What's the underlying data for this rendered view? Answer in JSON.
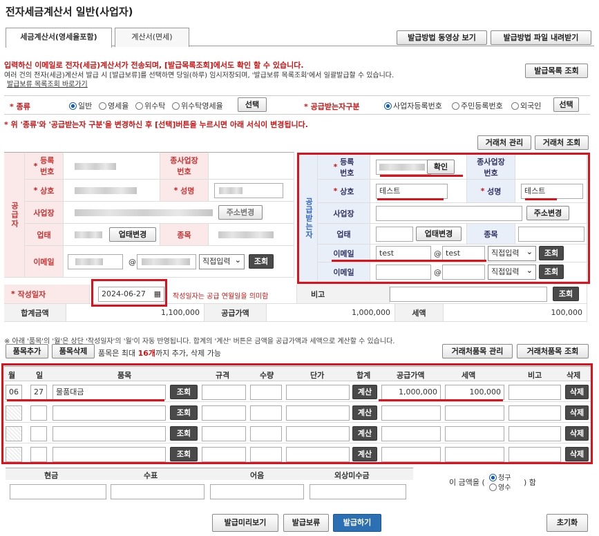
{
  "page_title": "전자세금계산서 일반(사업자)",
  "tabs": [
    "세금계산서(영세율포함)",
    "계산서(면세)"
  ],
  "top_buttons": {
    "video": "발급방법 동영상 보기",
    "download": "발급방법 파일 내려받기",
    "list": "발급목록 조회"
  },
  "notice": {
    "line1": "입력하신 이메일로 전자(세금)계산서가 전송되며, [발급목록조회]에서도 확인 할 수 있습니다.",
    "line2": "여러 건의 전자(세금)계산서 발급 시 [발급보류]를 선택하면 당일(하루) 임시저장되며, '발급보류 목록조회'에서 일괄발급할 수 있습니다.",
    "link": "발급보류 목록조회 바로가기"
  },
  "type_row": {
    "label": "종류",
    "options": [
      "일반",
      "영세율",
      "위수탁",
      "위수탁영세율"
    ],
    "select_btn": "선택",
    "recipient_label": "공급받는자구분",
    "recipient_options": [
      "사업자등록번호",
      "주민등록번호",
      "외국인"
    ],
    "recipient_btn": "선택"
  },
  "warning": "* 위 '종류'와 '공급받는자 구분'을 변경하신 후 [선택]버튼을 누르시면 아래 서식이 변경됩니다.",
  "partner_buttons": {
    "manage": "거래처 관리",
    "search": "거래처 조회"
  },
  "supplier": {
    "side_label": "공급자",
    "reg_no_label": "등록\n번호",
    "branch_label": "종사업장\n번호",
    "name_label": "상호",
    "ceo_label": "성명",
    "address_label": "사업장",
    "address_btn": "주소변경",
    "business_label": "업태",
    "business_btn": "업태변경",
    "item_label": "종목",
    "email_label": "이메일",
    "email_select": "직접입력",
    "email_btn": "조회"
  },
  "recipient": {
    "side_label": "공급받는자",
    "reg_no_label": "등록\n번호",
    "confirm_btn": "확인",
    "branch_label": "종사업장\n번호",
    "name_label": "상호",
    "name_value": "테스트",
    "ceo_label": "성명",
    "ceo_value": "테스트",
    "address_label": "사업장",
    "address_btn": "주소변경",
    "business_label": "업태",
    "business_btn": "업태변경",
    "item_label": "종목",
    "email_label": "이메일",
    "email_id": "test",
    "email_domain": "test",
    "email_select": "직접입력",
    "email_btn": "조회",
    "email2_label": "이메일",
    "email2_select": "직접입력",
    "email2_btn": "조회"
  },
  "date_row": {
    "label": "작성일자",
    "value": "2024-06-27",
    "hint": "작성일자는 공급 연월일을 의미함",
    "note_label": "비고",
    "note_btn": "조회"
  },
  "totals": {
    "total_label": "합계금액",
    "total": "1,100,000",
    "supply_label": "공급가액",
    "supply": "1,000,000",
    "tax_label": "세액",
    "tax": "100,000"
  },
  "items_notice": "※ 아래 '품목'의 '월'은 상단 '작성일자'의 '월'이 자동 반영됩니다. 합계의 '계산' 버튼은 금액을 공급가액과 세액으로 계산할 수 있습니다.",
  "items_toolbar": {
    "add": "품목추가",
    "delete": "품목삭제",
    "limit_pre": "품목은 최대 ",
    "limit_num": "16개",
    "limit_post": "까지 추가, 삭제 가능",
    "manage": "거래처품목 관리",
    "search": "거래처품목 조회"
  },
  "items_headers": [
    "월",
    "일",
    "품목",
    "규격",
    "수량",
    "단가",
    "합계",
    "공급가액",
    "세액",
    "비고",
    "삭제"
  ],
  "item_buttons": {
    "search": "조회",
    "calc": "계산",
    "delete": "삭제"
  },
  "items": [
    {
      "month": "06",
      "day": "27",
      "name": "물품대금",
      "supply": "1,000,000",
      "tax": "100,000"
    },
    {
      "month": "",
      "day": "",
      "name": "",
      "supply": "",
      "tax": ""
    },
    {
      "month": "",
      "day": "",
      "name": "",
      "supply": "",
      "tax": ""
    },
    {
      "month": "",
      "day": "",
      "name": "",
      "supply": "",
      "tax": ""
    }
  ],
  "payment": {
    "headers": [
      "현금",
      "수표",
      "어음",
      "외상미수금"
    ],
    "amount_pre": "이 금액을 (",
    "claim": "청구",
    "receipt": "영수",
    "amount_post": ") 함"
  },
  "bottom_buttons": {
    "preview": "발급미리보기",
    "hold": "발급보류",
    "issue": "발급하기",
    "reset": "초기화"
  }
}
